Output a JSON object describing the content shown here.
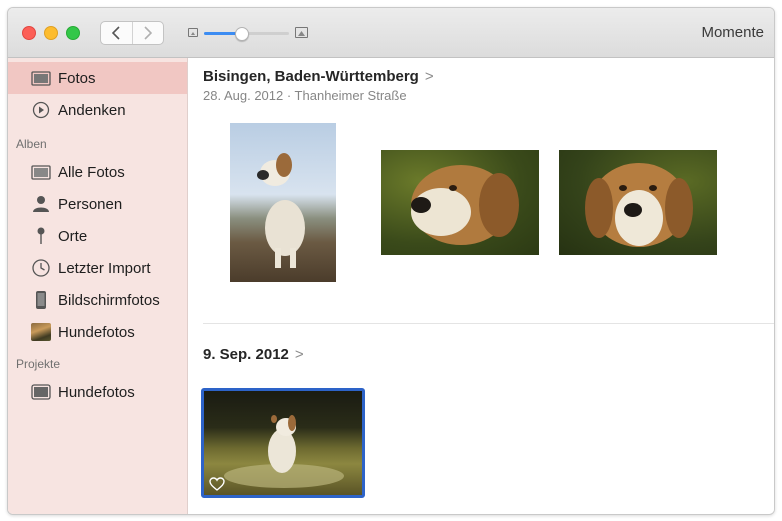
{
  "window": {
    "view_title": "Momente"
  },
  "toolbar": {
    "zoom_level": 0.45
  },
  "sidebar": {
    "top_items": [
      {
        "label": "Fotos",
        "icon": "photos-icon",
        "selected": true
      },
      {
        "label": "Andenken",
        "icon": "memories-icon",
        "selected": false
      }
    ],
    "albums_heading": "Alben",
    "albums": [
      {
        "label": "Alle Fotos",
        "icon": "all-photos-icon"
      },
      {
        "label": "Personen",
        "icon": "person-icon"
      },
      {
        "label": "Orte",
        "icon": "pin-icon"
      },
      {
        "label": "Letzter Import",
        "icon": "clock-icon"
      },
      {
        "label": "Bildschirmfotos",
        "icon": "phone-icon"
      },
      {
        "label": "Hundefotos",
        "icon": "album-thumbnail-icon"
      }
    ],
    "projects_heading": "Projekte",
    "projects": [
      {
        "label": "Hundefotos",
        "icon": "project-book-icon"
      }
    ]
  },
  "moments": [
    {
      "title": "Bisingen, Baden-Württemberg",
      "chevron": ">",
      "subtitle": "28. Aug. 2012 · Thanheimer Straße",
      "photo_count": 3
    },
    {
      "title": "9. Sep. 2012",
      "chevron": ">",
      "subtitle": "",
      "photo_count": 1
    }
  ],
  "colors": {
    "selection_border": "#2d63c8",
    "slider_fill": "#3c8cf2",
    "sidebar_bg": "#f7e4e1",
    "sidebar_selected": "#f1c7c3"
  }
}
